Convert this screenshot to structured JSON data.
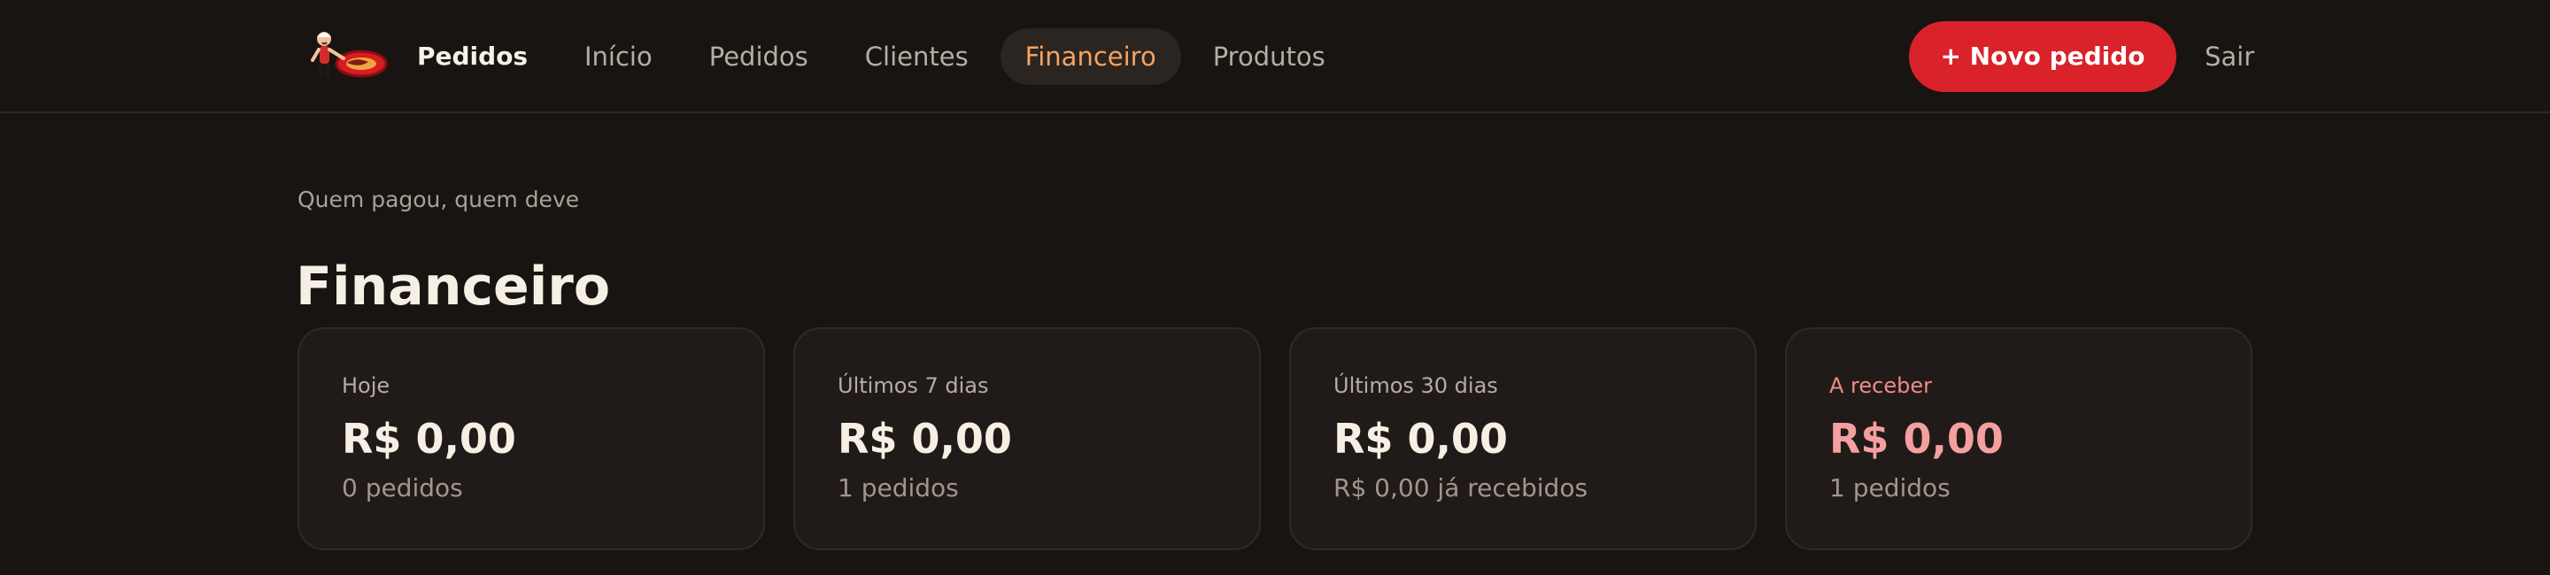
{
  "header": {
    "brand": "Pedidos",
    "logo_icon": "chef-mascot-icon",
    "nav": [
      {
        "label": "Início",
        "active": false
      },
      {
        "label": "Pedidos",
        "active": false
      },
      {
        "label": "Clientes",
        "active": false
      },
      {
        "label": "Financeiro",
        "active": true
      },
      {
        "label": "Produtos",
        "active": false
      }
    ],
    "new_order_label": "+ Novo pedido",
    "logout_label": "Sair"
  },
  "page": {
    "eyebrow": "Quem pagou, quem deve",
    "title": "Financeiro"
  },
  "cards": [
    {
      "label": "Hoje",
      "value": "R$ 0,00",
      "sub": "0 pedidos"
    },
    {
      "label": "Últimos 7 dias",
      "value": "R$ 0,00",
      "sub": "1 pedidos"
    },
    {
      "label": "Últimos 30 dias",
      "value": "R$ 0,00",
      "sub": "R$ 0,00 já recebidos"
    },
    {
      "label": "A receber",
      "value": "R$ 0,00",
      "sub": "1 pedidos",
      "highlight": true
    }
  ],
  "colors": {
    "background": "#181411",
    "card": "#201b18",
    "accent": "#d9222a",
    "active_nav": "#f2a463",
    "receivable": "#f4a0a0"
  }
}
